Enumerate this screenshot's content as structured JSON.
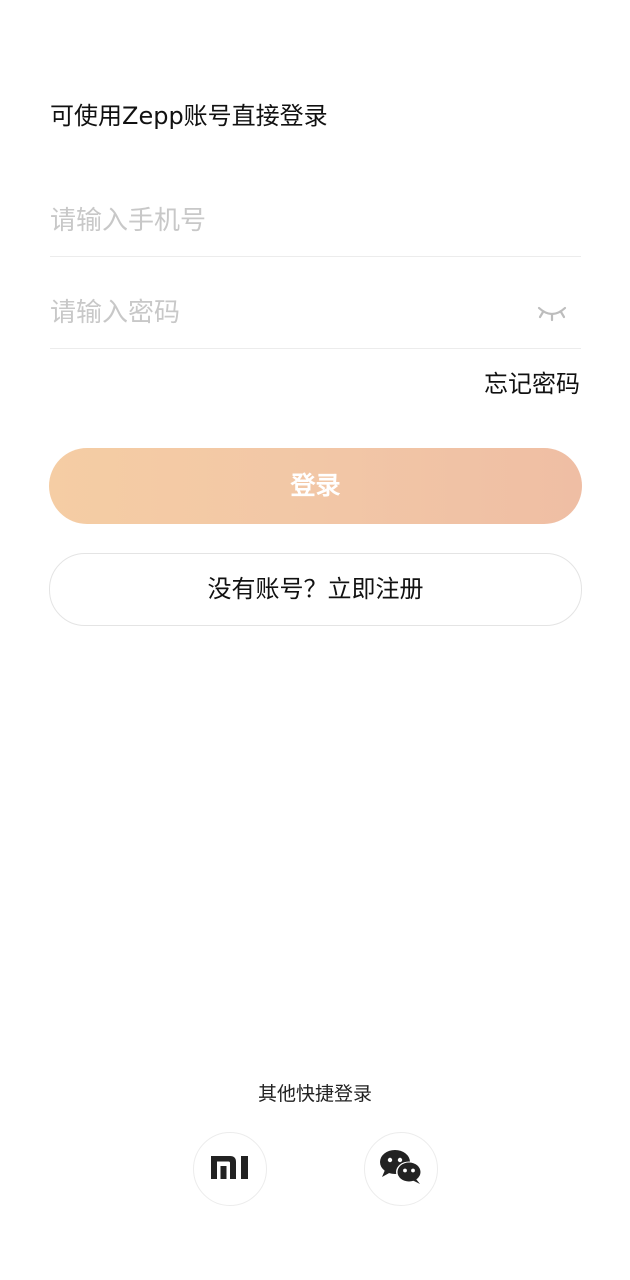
{
  "hint": "可使用Zepp账号直接登录",
  "phone": {
    "value": "",
    "placeholder": "请输入手机号"
  },
  "password": {
    "value": "",
    "placeholder": "请输入密码",
    "toggle_icon": "eye-closed-icon"
  },
  "forgot_label": "忘记密码",
  "login_label": "登录",
  "register_label": "没有账号？立即注册",
  "other_login": {
    "label": "其他快捷登录",
    "providers": [
      {
        "icon": "xiaomi-icon"
      },
      {
        "icon": "wechat-icon"
      }
    ]
  },
  "colors": {
    "button_gradient_start": "#f5cda4",
    "button_gradient_end": "#efbea4",
    "placeholder": "#c8c8c8",
    "text": "#111111"
  }
}
